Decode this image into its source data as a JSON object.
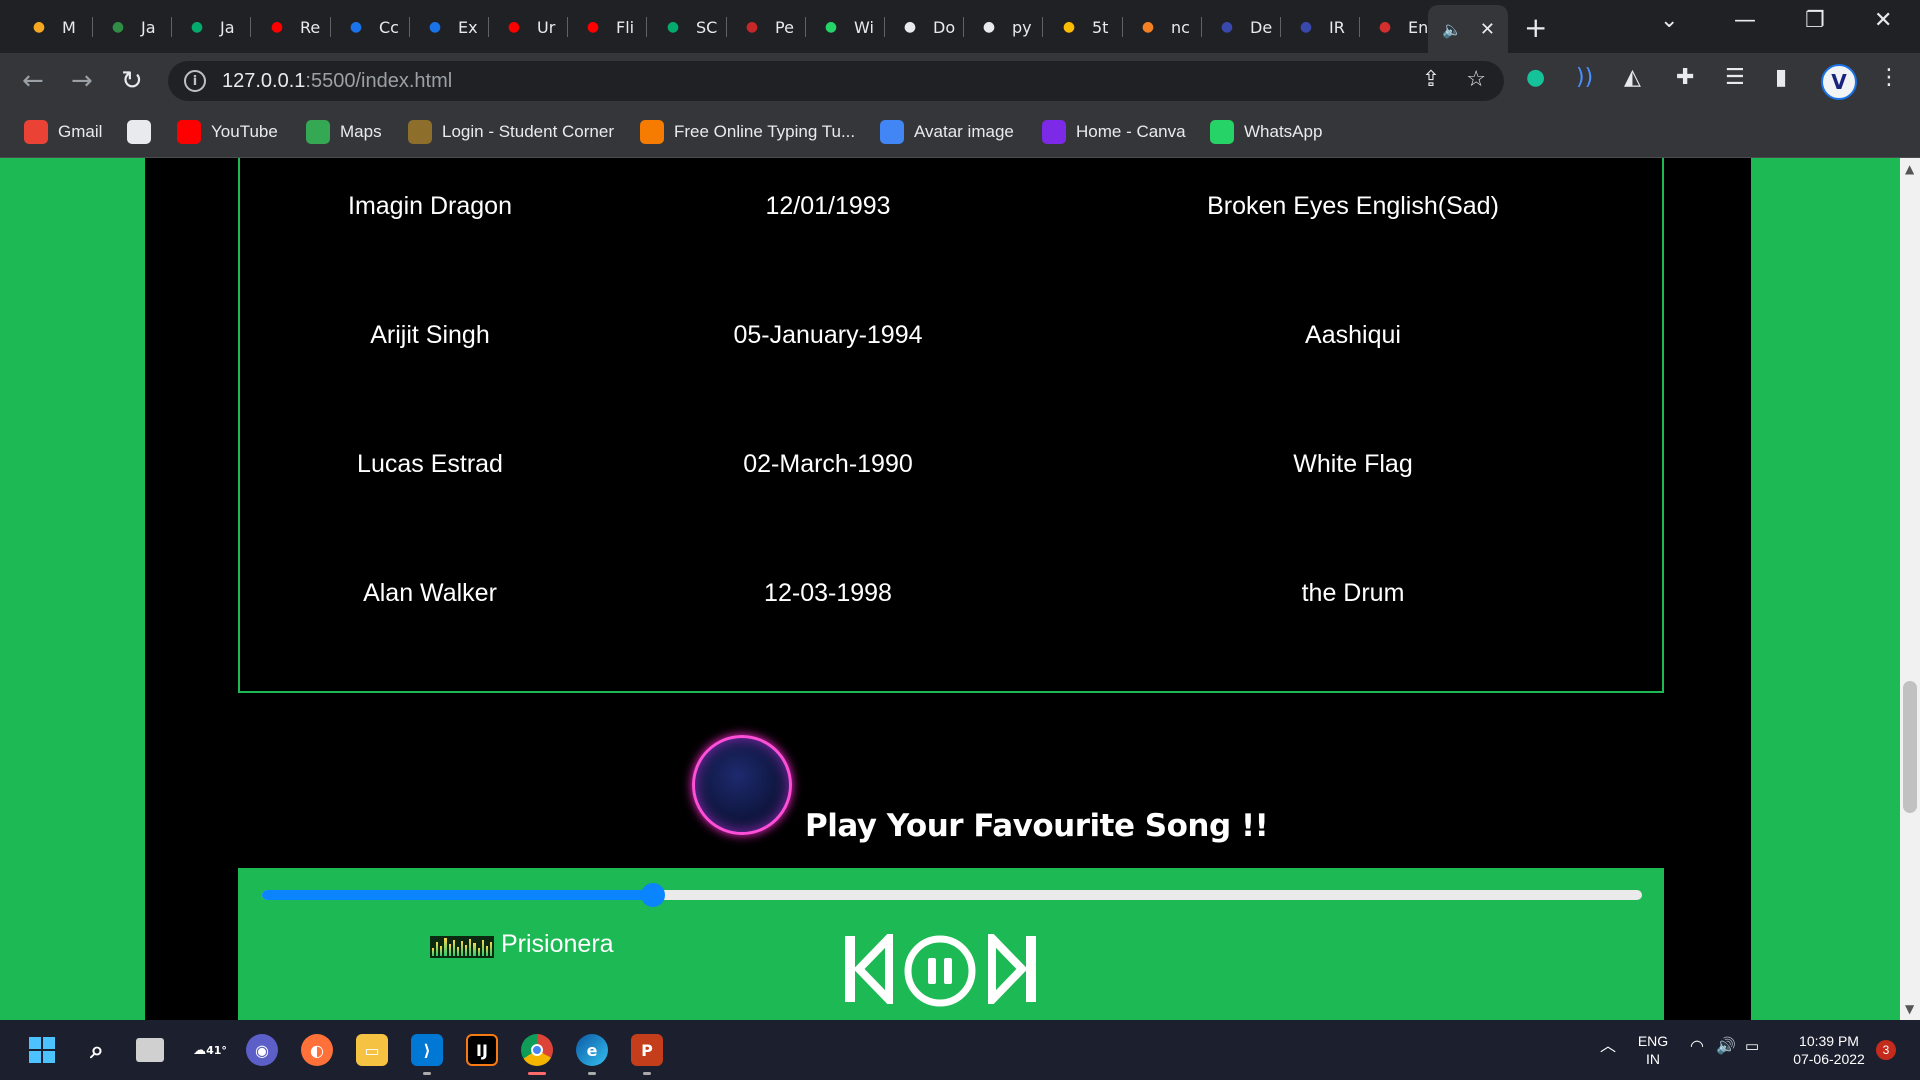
{
  "browser": {
    "tabs": [
      {
        "label": "M",
        "icon": "tab-favicon-m",
        "color": "#f6a821"
      },
      {
        "label": "Ja",
        "icon": "geeksforgeeks-icon",
        "color": "#2f8d46"
      },
      {
        "label": "Ja",
        "icon": "w3schools-icon",
        "color": "#04aa6d"
      },
      {
        "label": "Re",
        "icon": "youtube-icon",
        "color": "#ff0000"
      },
      {
        "label": "Cc",
        "icon": "codechef-icon",
        "color": "#1a73e8"
      },
      {
        "label": "Ex",
        "icon": "codechef-icon",
        "color": "#1a73e8"
      },
      {
        "label": "Ur",
        "icon": "youtube-icon",
        "color": "#ff0000"
      },
      {
        "label": "Fli",
        "icon": "youtube-icon",
        "color": "#ff0000"
      },
      {
        "label": "SC",
        "icon": "w3schools-icon",
        "color": "#04aa6d"
      },
      {
        "label": "Pe",
        "icon": "book-icon",
        "color": "#c62828"
      },
      {
        "label": "Wi",
        "icon": "whatsapp-icon",
        "color": "#25d366"
      },
      {
        "label": "Do",
        "icon": "download-icon",
        "color": "#e8eaed"
      },
      {
        "label": "py",
        "icon": "github-icon",
        "color": "#e8eaed"
      },
      {
        "label": "5t",
        "icon": "google-drive-icon",
        "color": "#fbbc04"
      },
      {
        "label": "nc",
        "icon": "stackoverflow-icon",
        "color": "#f48024"
      },
      {
        "label": "De",
        "icon": "portal-icon",
        "color": "#3949ab"
      },
      {
        "label": "IR",
        "icon": "portal-icon",
        "color": "#3949ab"
      },
      {
        "label": "En",
        "icon": "avatar-icon",
        "color": "#d32f2f"
      }
    ],
    "active_tab": {
      "icon": "speaker-muted-icon",
      "close": "✕"
    },
    "new_tab": "+",
    "url_host": "127.0.0.1",
    "url_rest": ":5500/index.html",
    "bookmarks": [
      {
        "label": "Gmail",
        "icon": "gmail-icon",
        "color": "#ea4335"
      },
      {
        "label": "",
        "icon": "github-icon",
        "color": "#e8eaed"
      },
      {
        "label": "YouTube",
        "icon": "youtube-icon",
        "color": "#ff0000"
      },
      {
        "label": "Maps",
        "icon": "maps-icon",
        "color": "#34a853"
      },
      {
        "label": "Login - Student Corner",
        "icon": "student-corner-icon",
        "color": "#8d6e2a"
      },
      {
        "label": "Free Online Typing Tu...",
        "icon": "typing-icon",
        "color": "#f57c00"
      },
      {
        "label": "Avatar image",
        "icon": "pinwheel-icon",
        "color": "#4285f4"
      },
      {
        "label": "Home - Canva",
        "icon": "canva-icon",
        "color": "#7d2ae8"
      },
      {
        "label": "WhatsApp",
        "icon": "whatsapp-icon",
        "color": "#25d366"
      }
    ]
  },
  "table": {
    "rows": [
      {
        "artist": "Imagin Dragon",
        "dob": "12/01/1993",
        "song": "Broken Eyes English(Sad)"
      },
      {
        "artist": "Arijit Singh",
        "dob": "05-January-1994",
        "song": "Aashiqui"
      },
      {
        "artist": "Lucas Estrad",
        "dob": "02-March-1990",
        "song": "White Flag"
      },
      {
        "artist": "Alan Walker",
        "dob": "12-03-1998",
        "song": "the Drum"
      }
    ]
  },
  "player": {
    "heading": "Play Your Favourite Song !!",
    "current_song": "Prisionera",
    "progress": 0.283,
    "accent_color": "#1db954",
    "progress_color": "#0a84ff"
  },
  "taskbar": {
    "weather_temp": "41°",
    "language_line1": "ENG",
    "language_line2": "IN",
    "time": "10:39 PM",
    "date": "07-06-2022",
    "notification_count": "3"
  }
}
